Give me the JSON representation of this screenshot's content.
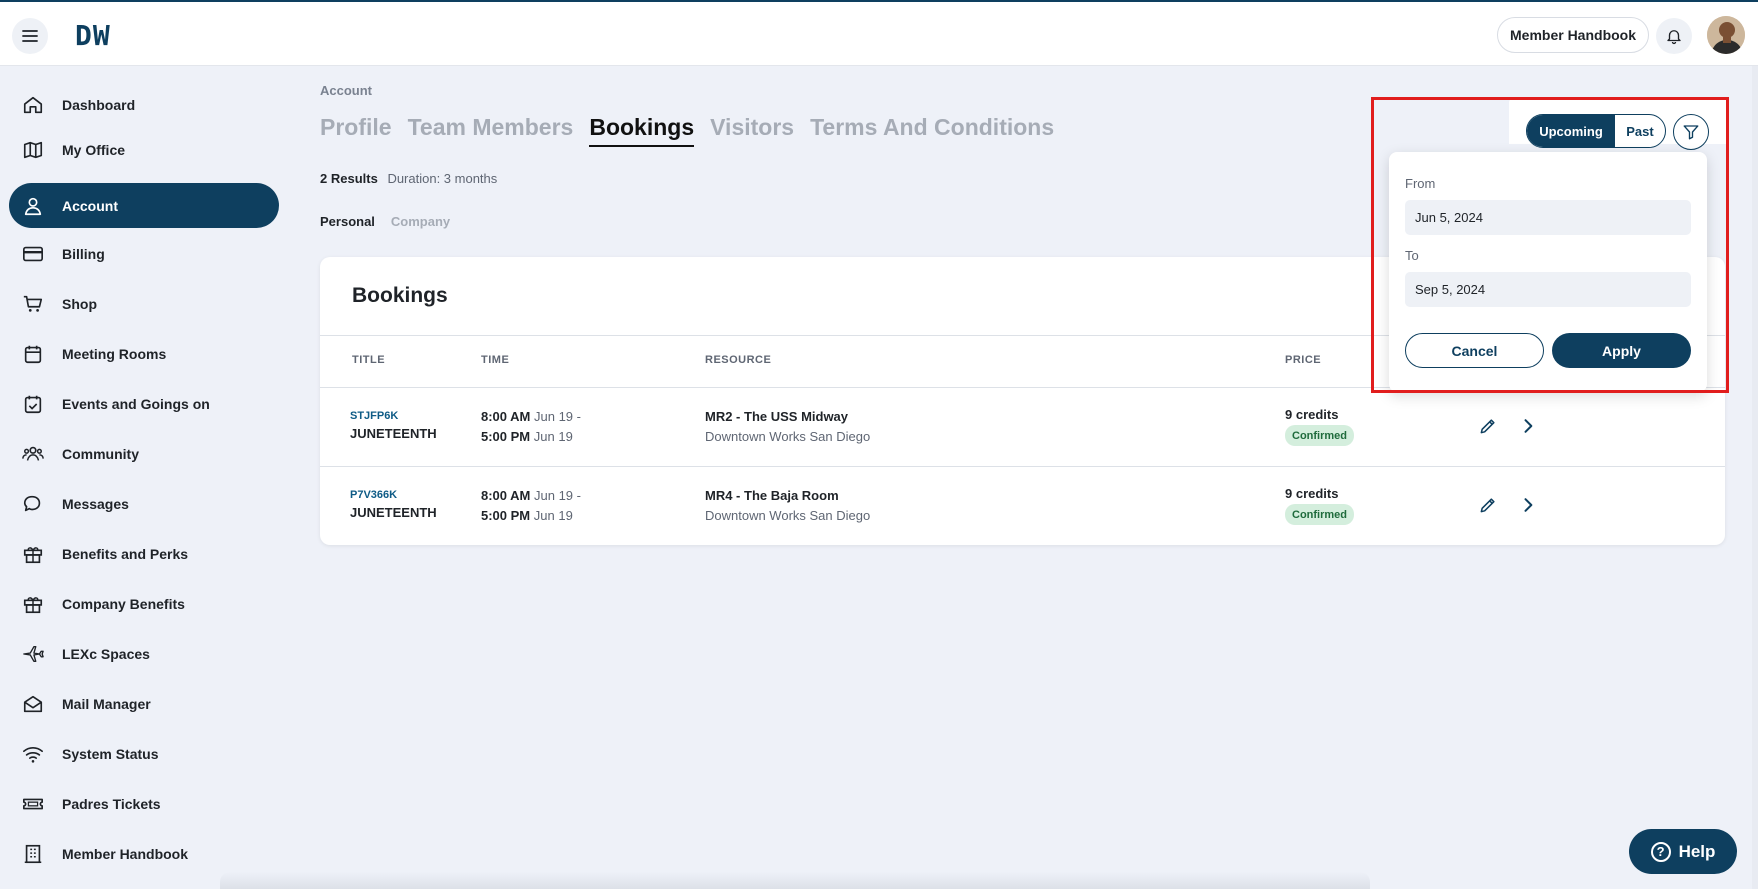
{
  "header": {
    "logo_text": "DW",
    "handbook_label": "Member Handbook"
  },
  "sidebar": {
    "items": [
      {
        "label": "Dashboard",
        "icon": "home-icon"
      },
      {
        "label": "My Office",
        "icon": "map-icon"
      },
      {
        "label": "Account",
        "icon": "user-icon"
      },
      {
        "label": "Billing",
        "icon": "credit-card-icon"
      },
      {
        "label": "Shop",
        "icon": "cart-icon"
      },
      {
        "label": "Meeting Rooms",
        "icon": "calendar-icon"
      },
      {
        "label": "Events and Goings on",
        "icon": "calendar-check-icon"
      },
      {
        "label": "Community",
        "icon": "users-icon"
      },
      {
        "label": "Messages",
        "icon": "chat-icon"
      },
      {
        "label": "Benefits and Perks",
        "icon": "gift-icon"
      },
      {
        "label": "Company Benefits",
        "icon": "gift-icon"
      },
      {
        "label": "LEXc Spaces",
        "icon": "plane-icon"
      },
      {
        "label": "Mail Manager",
        "icon": "mail-icon"
      },
      {
        "label": "System Status",
        "icon": "wifi-icon"
      },
      {
        "label": "Padres Tickets",
        "icon": "ticket-icon"
      },
      {
        "label": "Member Handbook",
        "icon": "building-icon"
      }
    ],
    "active": "Account"
  },
  "main": {
    "breadcrumb": "Account",
    "tabs": [
      "Profile",
      "Team Members",
      "Bookings",
      "Visitors",
      "Terms And Conditions"
    ],
    "active_tab": "Bookings",
    "results_count": "2 Results",
    "duration": "Duration: 3 months",
    "subtabs": [
      "Personal",
      "Company"
    ],
    "active_subtab": "Personal"
  },
  "bookings": {
    "title": "Bookings",
    "columns": [
      "TITLE",
      "TIME",
      "RESOURCE",
      "PRICE"
    ],
    "rows": [
      {
        "code": "STJFP6K",
        "name": "JUNETEENTH",
        "start_time": "8:00 AM",
        "start_date": "Jun 19 -",
        "end_time": "5:00 PM",
        "end_date": "Jun 19",
        "resource": "MR2 - The USS Midway",
        "location": "Downtown Works San Diego",
        "price": "9 credits",
        "status": "Confirmed"
      },
      {
        "code": "P7V366K",
        "name": "JUNETEENTH",
        "start_time": "8:00 AM",
        "start_date": "Jun 19 -",
        "end_time": "5:00 PM",
        "end_date": "Jun 19",
        "resource": "MR4 - The Baja Room",
        "location": "Downtown Works San Diego",
        "price": "9 credits",
        "status": "Confirmed"
      }
    ]
  },
  "filter": {
    "toggle": {
      "upcoming": "Upcoming",
      "past": "Past",
      "selected": "Upcoming"
    },
    "from_label": "From",
    "from_value": "Jun 5, 2024",
    "to_label": "To",
    "to_value": "Sep 5, 2024",
    "cancel_label": "Cancel",
    "apply_label": "Apply"
  },
  "help": {
    "label": "Help"
  },
  "colors": {
    "brand": "#0e3f5f",
    "background": "#eef1f8",
    "confirmed_bg": "#d4eedd",
    "highlight": "#e11d1d"
  }
}
